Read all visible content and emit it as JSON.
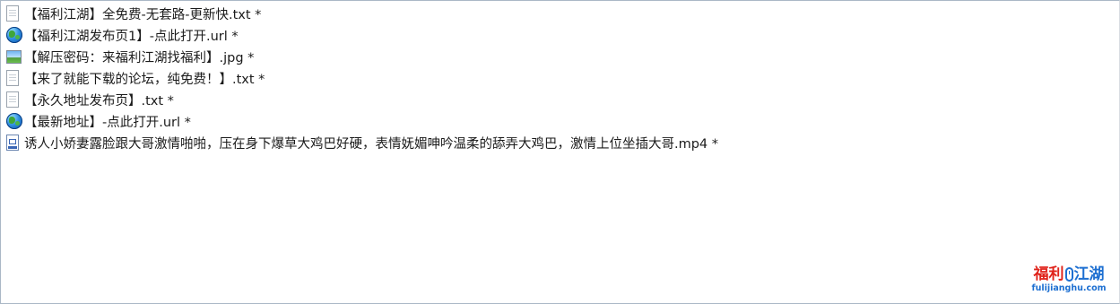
{
  "files": [
    {
      "icon": "text-file-icon",
      "name": "【福利江湖】全免费-无套路-更新快.txt *"
    },
    {
      "icon": "globe-url-icon",
      "name": "【福利江湖发布页1】-点此打开.url *"
    },
    {
      "icon": "image-file-icon",
      "name": "【解压密码：来福利江湖找福利】.jpg *"
    },
    {
      "icon": "text-file-icon",
      "name": "【来了就能下载的论坛，纯免费！】.txt *"
    },
    {
      "icon": "text-file-icon",
      "name": "【永久地址发布页】.txt *"
    },
    {
      "icon": "globe-url-icon",
      "name": "【最新地址】-点此打开.url *"
    },
    {
      "icon": "video-file-icon",
      "name": "诱人小娇妻露脸跟大哥激情啪啪，压在身下爆草大鸡巴好硬，表情妩媚呻吟温柔的舔弄大鸡巴，激情上位坐插大哥.mp4 *"
    }
  ],
  "watermark": {
    "title_left": "福利",
    "title_right": "江湖",
    "url": "fulijianghu.com"
  },
  "colors": {
    "border": "#aab8c6",
    "text": "#1b1b1b",
    "watermark_red": "#e0231b",
    "watermark_blue": "#1d6fd1"
  }
}
